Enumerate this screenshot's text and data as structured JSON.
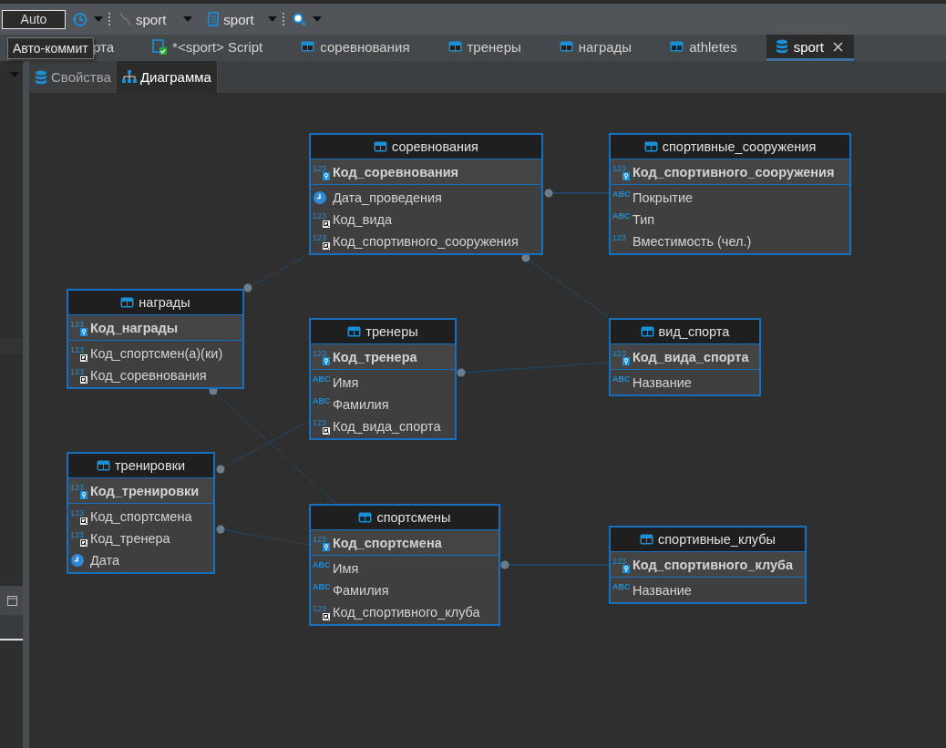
{
  "toolbar": {
    "commit_mode": "Auto",
    "connection": "sport",
    "database": "sport"
  },
  "tooltip": "Авто-коммит",
  "editor_tabs": [
    {
      "label": "рта",
      "kind": "hidden",
      "selected": false
    },
    {
      "label": "*<sport> Script",
      "kind": "script",
      "selected": false
    },
    {
      "label": "соревнования",
      "kind": "table",
      "selected": false
    },
    {
      "label": "тренеры",
      "kind": "table",
      "selected": false
    },
    {
      "label": "награды",
      "kind": "table",
      "selected": false
    },
    {
      "label": "athletes",
      "kind": "table",
      "selected": false
    },
    {
      "label": "sport",
      "kind": "database",
      "selected": true
    }
  ],
  "sub_tabs": [
    {
      "label": "Свойства",
      "kind": "database",
      "selected": false
    },
    {
      "label": "Диаграмма",
      "kind": "diagram",
      "selected": true
    }
  ],
  "diagram": {
    "tables": [
      {
        "name": "соревнования",
        "key": {
          "name": "Код_соревнования",
          "type_label": "123"
        },
        "columns": [
          {
            "name": "Дата_проведения",
            "kind": "date"
          },
          {
            "name": "Код_вида",
            "kind": "fk",
            "type_label": "123"
          },
          {
            "name": "Код_спортивного_сооружения",
            "kind": "fk",
            "type_label": "123"
          }
        ]
      },
      {
        "name": "спортивные_сооружения",
        "key": {
          "name": "Код_спортивного_сооружения",
          "type_label": "123"
        },
        "columns": [
          {
            "name": "Покрытие",
            "kind": "text",
            "type_label": "ABC"
          },
          {
            "name": "Тип",
            "kind": "text",
            "type_label": "ABC"
          },
          {
            "name": "Вместимость (чел.)",
            "kind": "number",
            "type_label": "123"
          }
        ]
      },
      {
        "name": "награды",
        "key": {
          "name": "Код_награды",
          "type_label": "123"
        },
        "columns": [
          {
            "name": "Код_спортсмен(а)(ки)",
            "kind": "fk",
            "type_label": "123"
          },
          {
            "name": "Код_соревнования",
            "kind": "fk",
            "type_label": "123"
          }
        ]
      },
      {
        "name": "тренеры",
        "key": {
          "name": "Код_тренера",
          "type_label": "123"
        },
        "columns": [
          {
            "name": "Имя",
            "kind": "text",
            "type_label": "ABC"
          },
          {
            "name": "Фамилия",
            "kind": "text",
            "type_label": "ABC"
          },
          {
            "name": "Код_вида_спорта",
            "kind": "fk",
            "type_label": "123"
          }
        ]
      },
      {
        "name": "вид_спорта",
        "key": {
          "name": "Код_вида_спорта",
          "type_label": "123"
        },
        "columns": [
          {
            "name": "Название",
            "kind": "text",
            "type_label": "ABC"
          }
        ]
      },
      {
        "name": "тренировки",
        "key": {
          "name": "Код_тренировки",
          "type_label": "123"
        },
        "columns": [
          {
            "name": "Код_спортсмена",
            "kind": "fk",
            "type_label": "123"
          },
          {
            "name": "Код_тренера",
            "kind": "fk",
            "type_label": "123"
          },
          {
            "name": "Дата",
            "kind": "date"
          }
        ]
      },
      {
        "name": "спортсмены",
        "key": {
          "name": "Код_спортсмена",
          "type_label": "123"
        },
        "columns": [
          {
            "name": "Имя",
            "kind": "text",
            "type_label": "ABC"
          },
          {
            "name": "Фамилия",
            "kind": "text",
            "type_label": "ABC"
          },
          {
            "name": "Код_спортивного_клуба",
            "kind": "fk",
            "type_label": "123"
          }
        ]
      },
      {
        "name": "спортивные_клубы",
        "key": {
          "name": "Код_спортивного_клуба",
          "type_label": "123"
        },
        "columns": [
          {
            "name": "Название",
            "kind": "text",
            "type_label": "ABC"
          }
        ]
      }
    ]
  }
}
